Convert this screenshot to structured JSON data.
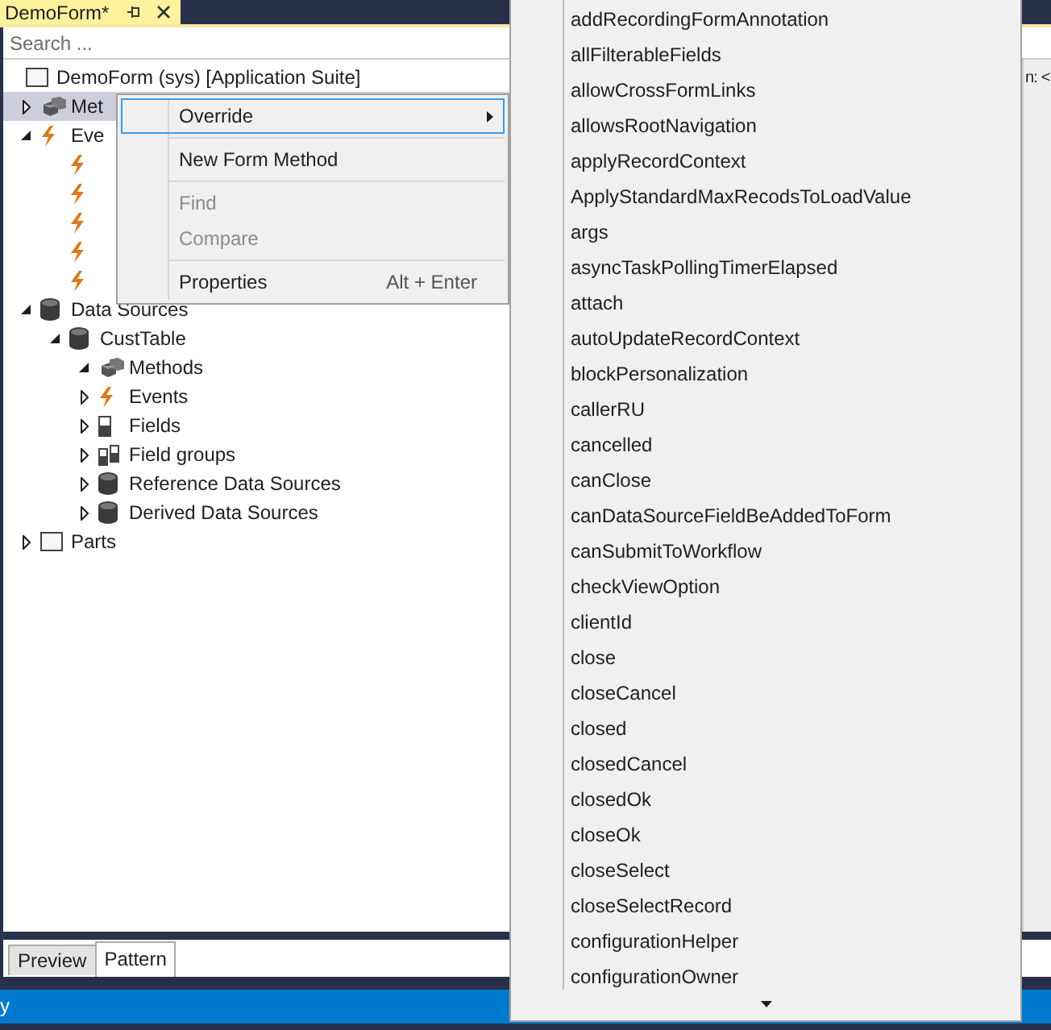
{
  "document_tab": {
    "title": "DemoForm*",
    "selected": true
  },
  "search": {
    "placeholder": "Search ..."
  },
  "tree": [
    {
      "label": "DemoForm (sys) [Application Suite]",
      "kind": "form",
      "selected": false,
      "children": [
        {
          "label": "Met",
          "kind": "methods",
          "expanded": false,
          "selected": true
        },
        {
          "label": "Eve",
          "kind": "events",
          "expanded": true,
          "selected": false,
          "children": [
            {
              "kind": "event",
              "selected": false
            },
            {
              "kind": "event",
              "selected": false
            },
            {
              "kind": "event",
              "selected": false
            },
            {
              "kind": "event",
              "selected": false
            },
            {
              "kind": "event",
              "selected": false
            }
          ]
        },
        {
          "label": "Data Sources",
          "kind": "datasource",
          "expanded": true,
          "selected": false,
          "children": [
            {
              "label": "CustTable",
              "kind": "datasource",
              "expanded": true,
              "selected": false,
              "children": [
                {
                  "label": "Methods",
                  "kind": "methods",
                  "expanded": true,
                  "selected": false
                },
                {
                  "label": "Events",
                  "kind": "events",
                  "expanded": false,
                  "selected": false
                },
                {
                  "label": "Fields",
                  "kind": "fields",
                  "expanded": false,
                  "selected": false
                },
                {
                  "label": "Field groups",
                  "kind": "fieldgroups",
                  "expanded": false,
                  "selected": false
                },
                {
                  "label": "Reference Data Sources",
                  "kind": "datasource",
                  "expanded": false,
                  "selected": false
                },
                {
                  "label": "Derived Data Sources",
                  "kind": "datasource",
                  "expanded": false,
                  "selected": false
                }
              ]
            }
          ]
        },
        {
          "label": "Parts",
          "kind": "form",
          "expanded": false,
          "selected": false
        }
      ]
    }
  ],
  "side_panel": {
    "text": "n: <"
  },
  "context_menu": {
    "items": [
      {
        "kind": "item",
        "label": "Override",
        "has_submenu": true,
        "selected": true,
        "disabled": false
      },
      {
        "kind": "separator"
      },
      {
        "kind": "item",
        "label": "New Form Method",
        "has_submenu": false,
        "selected": false,
        "disabled": false
      },
      {
        "kind": "separator"
      },
      {
        "kind": "item",
        "label": "Find",
        "has_submenu": false,
        "selected": false,
        "disabled": true
      },
      {
        "kind": "item",
        "label": "Compare",
        "has_submenu": false,
        "selected": false,
        "disabled": true
      },
      {
        "kind": "separator"
      },
      {
        "kind": "item",
        "label": "Properties",
        "shortcut": "Alt + Enter",
        "has_submenu": false,
        "selected": false,
        "disabled": false
      }
    ]
  },
  "submenu": {
    "items": [
      "addRecordingFormAnnotation",
      "allFilterableFields",
      "allowCrossFormLinks",
      "allowsRootNavigation",
      "applyRecordContext",
      "ApplyStandardMaxRecodsToLoadValue",
      "args",
      "asyncTaskPollingTimerElapsed",
      "attach",
      "autoUpdateRecordContext",
      "blockPersonalization",
      "callerRU",
      "cancelled",
      "canClose",
      "canDataSourceFieldBeAddedToForm",
      "canSubmitToWorkflow",
      "checkViewOption",
      "clientId",
      "close",
      "closeCancel",
      "closed",
      "closedCancel",
      "closedOk",
      "closeOk",
      "closeSelect",
      "closeSelectRecord",
      "configurationHelper",
      "configurationOwner"
    ],
    "more_below": true
  },
  "bottom_tabs": [
    {
      "label": "Preview",
      "selected": false
    },
    {
      "label": "Pattern",
      "selected": true
    }
  ],
  "status_bar": {
    "text": "y"
  }
}
